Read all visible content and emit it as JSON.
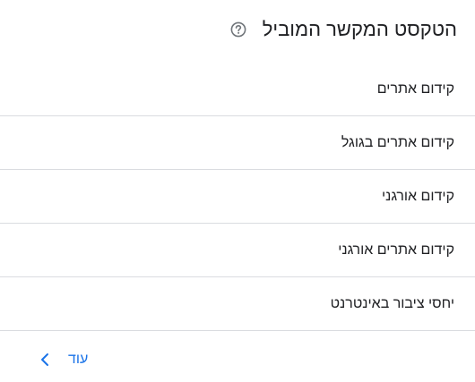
{
  "header": {
    "title": "הטקסט המקשר המוביל"
  },
  "items": [
    {
      "label": "קידום אתרים"
    },
    {
      "label": "קידום אתרים בגוגל"
    },
    {
      "label": "קידום אורגני"
    },
    {
      "label": "קידום אתרים אורגני"
    },
    {
      "label": "יחסי ציבור באינטרנט"
    }
  ],
  "footer": {
    "more_label": "עוד"
  },
  "colors": {
    "text": "#202124",
    "link": "#1a73e8",
    "divider": "#dadce0",
    "icon": "#70757a"
  },
  "icons": {
    "help": "help-circle-icon",
    "more": "chevron-left-icon"
  }
}
